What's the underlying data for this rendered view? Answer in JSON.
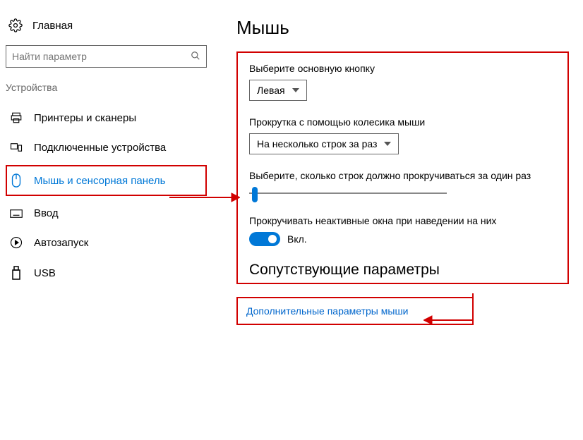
{
  "sidebar": {
    "home_label": "Главная",
    "search_placeholder": "Найти параметр",
    "section_label": "Устройства",
    "items": [
      {
        "label": "Принтеры и сканеры"
      },
      {
        "label": "Подключенные устройства"
      },
      {
        "label": "Мышь и сенсорная панель"
      },
      {
        "label": "Ввод"
      },
      {
        "label": "Автозапуск"
      },
      {
        "label": "USB"
      }
    ]
  },
  "main": {
    "title": "Мышь",
    "primary_button_label": "Выберите основную кнопку",
    "primary_button_value": "Левая",
    "scroll_label": "Прокрутка с помощью колесика мыши",
    "scroll_value": "На несколько строк за раз",
    "lines_label": "Выберите, сколько строк должно прокручиваться за один раз",
    "inactive_label": "Прокручивать неактивные окна при наведении на них",
    "toggle_state": "Вкл.",
    "related_title": "Сопутствующие параметры",
    "related_link": "Дополнительные параметры мыши"
  }
}
